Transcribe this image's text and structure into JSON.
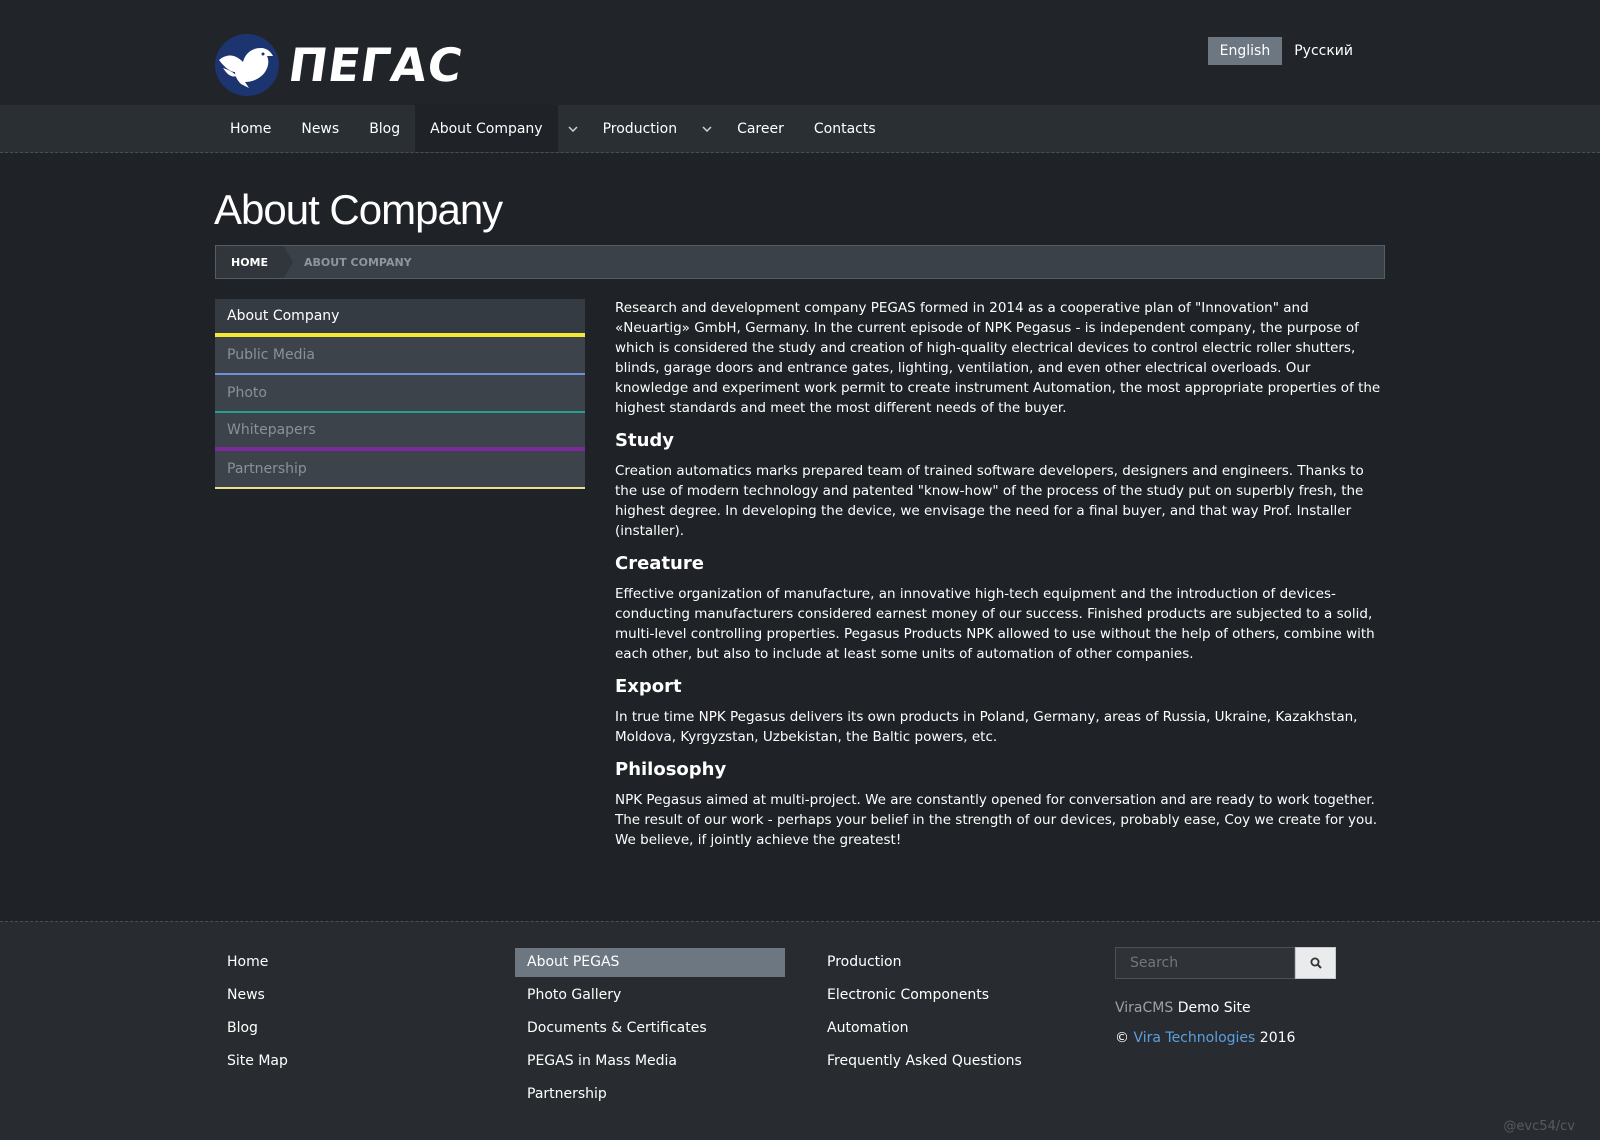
{
  "header": {
    "logo_text": "ПЕГАС",
    "languages": [
      {
        "label": "English",
        "active": true
      },
      {
        "label": "Русский",
        "active": false
      }
    ]
  },
  "nav": {
    "items": [
      {
        "label": "Home"
      },
      {
        "label": "News"
      },
      {
        "label": "Blog"
      },
      {
        "label": "About Company",
        "active": true,
        "has_dropdown": true
      },
      {
        "label": "Production",
        "has_dropdown": true
      },
      {
        "label": "Career"
      },
      {
        "label": "Contacts"
      }
    ]
  },
  "page": {
    "title": "About Company",
    "breadcrumb": {
      "home": "HOME",
      "current": "ABOUT COMPANY"
    }
  },
  "sidebar": {
    "items": [
      {
        "label": "About Company",
        "active": true,
        "color": "#f5e735"
      },
      {
        "label": "Public Media",
        "color": "#6d8fd6"
      },
      {
        "label": "Photo",
        "color": "#2a9e96"
      },
      {
        "label": "Whitepapers",
        "color": "#7a2a9c"
      },
      {
        "label": "Partnership",
        "color": "#e8e08a"
      }
    ]
  },
  "content": {
    "intro": "Research and development company PEGAS formed in 2014 as a cooperative plan of \"Innovation\" and «Neuartig» GmbH, Germany. In the current episode of NPK Pegasus - is independent company, the purpose of which is considered the study and creation of high-quality electrical devices to control electric roller shutters, blinds, garage doors and entrance gates, lighting, ventilation, and even other electrical overloads. Our knowledge and experiment work permit to create instrument Automation, the most appropriate properties of the highest standards and meet the most different needs of the buyer.",
    "sections": [
      {
        "heading": "Study",
        "text": "Creation automatics marks prepared team of trained software developers, designers and engineers. Thanks to the use of modern technology and patented \"know-how\" of the process of the study put on superbly fresh, the highest degree. In developing the device, we envisage the need for a final buyer, and that way Prof. Installer (installer)."
      },
      {
        "heading": "Creature",
        "text": "Effective organization of manufacture, an innovative high-tech equipment and the introduction of devices-conducting manufacturers considered earnest money of our success. Finished products are subjected to a solid, multi-level controlling properties. Pegasus Products NPK allowed to use without the help of others, combine with each other, but also to include at least some units of automation of other companies."
      },
      {
        "heading": "Export",
        "text": "In true time NPK Pegasus delivers its own products in Poland, Germany, areas of Russia, Ukraine, Kazakhstan, Moldova, Kyrgyzstan, Uzbekistan, the Baltic powers, etc."
      },
      {
        "heading": "Philosophy",
        "text": "NPK Pegasus aimed at multi-project. We are constantly opened for conversation and are ready to work together. The result of our work - perhaps your belief in the strength of our devices, probably ease, Coy we create for you. We believe, if jointly achieve the greatest!"
      }
    ]
  },
  "footer": {
    "col1": [
      "Home",
      "News",
      "Blog",
      "Site Map"
    ],
    "col2": [
      "About PEGAS",
      "Photo Gallery",
      "Documents & Certificates",
      "PEGAS in Mass Media",
      "Partnership"
    ],
    "col3": [
      "Production",
      "Electronic Components",
      "Automation",
      "Frequently Asked Questions"
    ],
    "search_placeholder": "Search",
    "cms_name": "ViraCMS",
    "demo_label": "Demo Site",
    "copyright_symbol": "©",
    "company_link": "Vira Technologies",
    "year": "2016",
    "watermark": "@evc54/cv"
  }
}
